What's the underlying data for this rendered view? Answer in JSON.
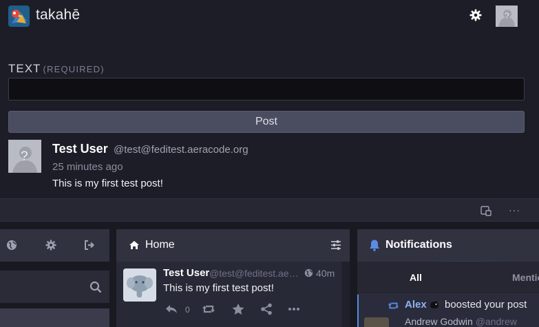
{
  "app": {
    "name": "takahē"
  },
  "header": {
    "settings_icon": "gear-icon",
    "avatar_icon": "default-avatar-icon"
  },
  "compose": {
    "label": "TEXT",
    "label_note": "(REQUIRED)",
    "text_value": "",
    "post_button": "Post"
  },
  "post": {
    "display_name": "Test User",
    "handle": "@test@feditest.aeracode.org",
    "time": "25 minutes ago",
    "content": "This is my first test post!"
  },
  "strip": {
    "icon_a": "open-in-window-icon",
    "more": "···"
  },
  "nav": {
    "icons": [
      "globe-icon",
      "gear-icon",
      "sign-out-icon"
    ],
    "search_icon": "search-icon"
  },
  "home": {
    "title": "Home",
    "card": {
      "name": "Test User",
      "handle": "@test@feditest.aeracode.org",
      "time": "40m",
      "content": "This is my first test post!",
      "reply_count": "0"
    }
  },
  "notifications": {
    "title": "Notifications",
    "tabs": [
      "All",
      "Mentions"
    ],
    "item": {
      "name": "Alex",
      "action": "boosted your post",
      "sub_name": "Andrew Godwin",
      "sub_handle": "@andrew"
    }
  },
  "colors": {
    "background": "#1c1d27",
    "accent": "#8fb2f0",
    "button": "#4a4c5f"
  }
}
